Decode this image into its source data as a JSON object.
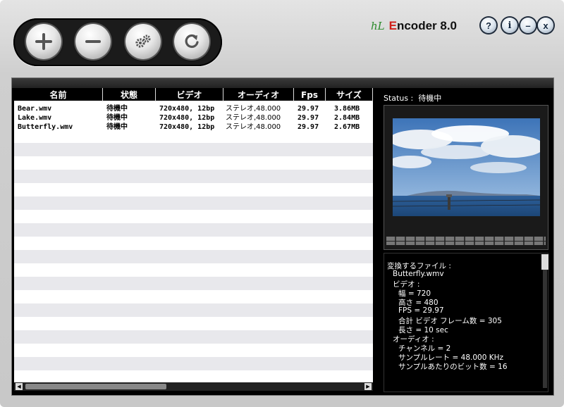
{
  "toolbar": {
    "buttons": [
      {
        "name": "add-button",
        "icon": "plus-icon"
      },
      {
        "name": "remove-button",
        "icon": "minus-icon"
      },
      {
        "name": "settings-button",
        "icon": "gears-icon"
      },
      {
        "name": "refresh-button",
        "icon": "refresh-icon"
      }
    ]
  },
  "brand": {
    "logo": "hL",
    "e": "E",
    "rest": "ncoder 8.0"
  },
  "window_buttons": {
    "help": "?",
    "info": "i",
    "minimize": "–",
    "close": "x"
  },
  "table": {
    "headers": [
      "名前",
      "状態",
      "ビデオ",
      "オーディオ",
      "Fps",
      "サイズ"
    ],
    "rows": [
      [
        "Bear.wmv",
        "待機中",
        "720x480, 12bp",
        "ステレオ,48.000",
        "29.97",
        "3.86MB"
      ],
      [
        "Lake.wmv",
        "待機中",
        "720x480, 12bp",
        "ステレオ,48.000",
        "29.97",
        "2.84MB"
      ],
      [
        "Butterfly.wmv",
        "待機中",
        "720x480, 12bp",
        "ステレオ,48.000",
        "29.97",
        "2.67MB"
      ]
    ]
  },
  "status": {
    "label": "Status :",
    "value": "待機中"
  },
  "info": {
    "heading": "変換するファイル :",
    "filename": "Butterfly.wmv",
    "video_label": "ビデオ :",
    "width": "幅 = 720",
    "height": "高さ = 480",
    "fps": "FPS = 29.97",
    "frames": "合計 ビデオ フレーム数 = 305",
    "length": "長さ = 10 sec",
    "audio_label": "オーディオ :",
    "channels": "チャンネル = 2",
    "sample_rate": "サンプルレート = 48.000 KHz",
    "bits": "サンプルあたりのビット数 = 16"
  },
  "colors": {
    "accent_red": "#d0201a",
    "logo_green": "#2a8a2a",
    "panel_black": "#000000"
  }
}
